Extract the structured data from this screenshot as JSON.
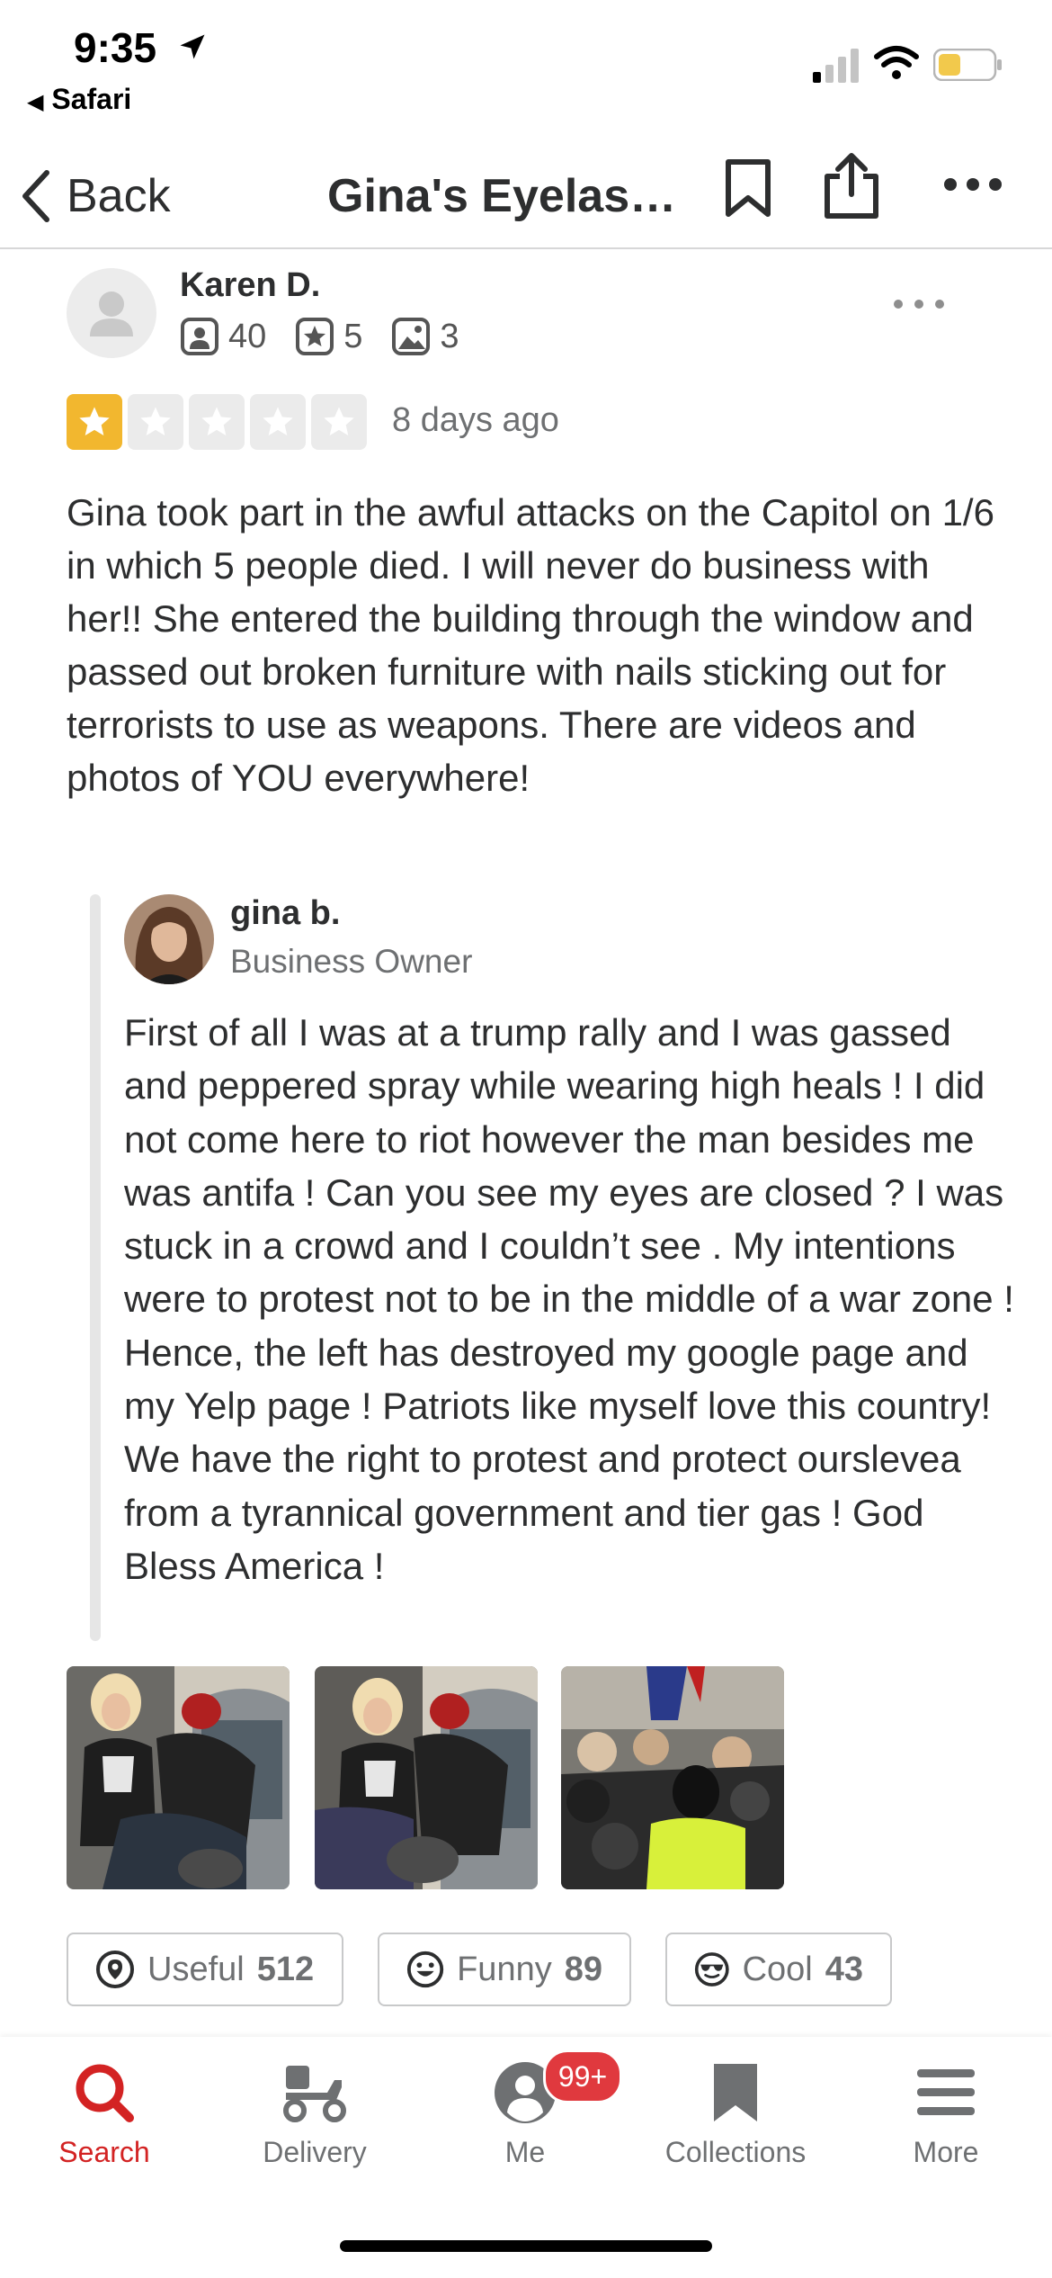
{
  "status": {
    "time": "9:35",
    "back_app": "Safari"
  },
  "nav": {
    "back_label": "Back",
    "title": "Gina's Eyelash..."
  },
  "review": {
    "author": "Karen D.",
    "friends": "40",
    "reviews": "5",
    "photos": "3",
    "rating": 1,
    "rating_max": 5,
    "date": "8 days ago",
    "text": "Gina took part in the awful attacks on the Capitol on 1/6 in which 5 people died. I will never do business with her!! She entered the building through the window and passed out broken furniture with nails sticking out for terrorists to use as weapons. There are videos and photos of YOU everywhere!"
  },
  "owner_reply": {
    "name": "gina b.",
    "role": "Business Owner",
    "text": "First of all I was at a trump rally and I was gassed and peppered spray while wearing high heals ! I did not come here to riot however the man besides me was antifa ! Can you see my eyes are closed ? I was stuck in a crowd and I couldn’t see . My intentions were to protest not to be in the middle of a war zone ! Hence, the left has destroyed my google page and my Yelp page ! Patriots like myself love this country! We have the right to protest and protect ourslevea from a tyrannical government and tier gas ! God Bless America !"
  },
  "reactions": {
    "useful_label": "Useful",
    "useful_count": "512",
    "funny_label": "Funny",
    "funny_count": "89",
    "cool_label": "Cool",
    "cool_count": "43"
  },
  "tabs": {
    "search": "Search",
    "delivery": "Delivery",
    "me": "Me",
    "me_badge": "99+",
    "collections": "Collections",
    "more": "More"
  },
  "colors": {
    "accent_red": "#d32323",
    "star_gold": "#f2b72f",
    "badge_red": "#e0393e",
    "text": "#2d2e2f"
  }
}
